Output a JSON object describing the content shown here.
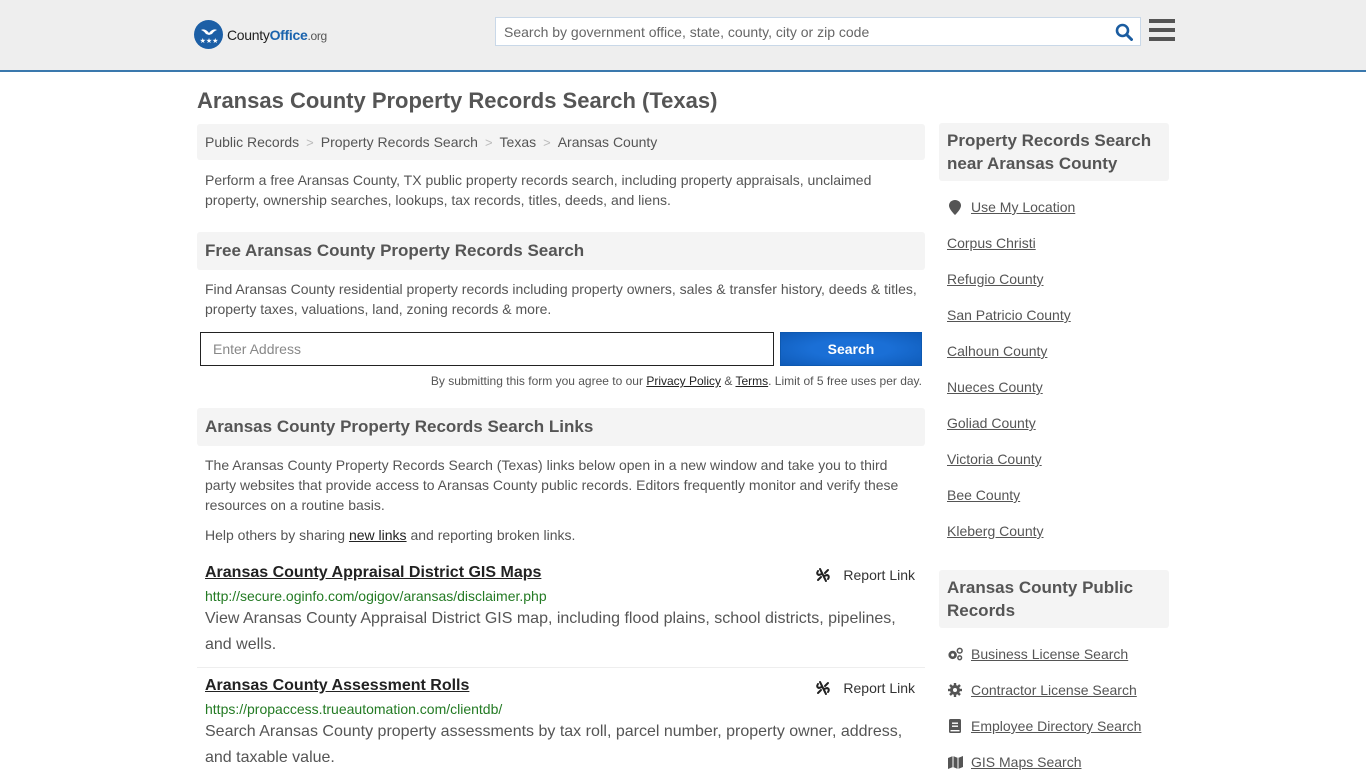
{
  "header": {
    "logo": {
      "county": "County",
      "office": "Office",
      "tld": ".org"
    },
    "search_placeholder": "Search by government office, state, county, city or zip code",
    "search_icon": "search-icon",
    "menu_icon": "hamburger-menu-icon",
    "brand_color": "#1c5fa6",
    "border_color": "#3a78ad"
  },
  "page": {
    "title": "Aransas County Property Records Search (Texas)"
  },
  "breadcrumb": [
    {
      "label": "Public Records"
    },
    {
      "label": "Property Records Search"
    },
    {
      "label": "Texas"
    },
    {
      "label": "Aransas County"
    }
  ],
  "intro": "Perform a free Aransas County, TX public property records search, including property appraisals, unclaimed property, ownership searches, lookups, tax records, titles, deeds, and liens.",
  "free_search": {
    "heading": "Free Aransas County Property Records Search",
    "description": "Find Aransas County residential property records including property owners, sales & transfer history, deeds & titles, property taxes, valuations, land, zoning records & more.",
    "address_placeholder": "Enter Address",
    "address_value": "",
    "button_label": "Search",
    "disclaimer_pre": "By submitting this form you agree to our ",
    "privacy_label": "Privacy Policy",
    "amp": " & ",
    "terms_label": "Terms",
    "disclaimer_post": ". Limit of 5 free uses per day."
  },
  "links_section": {
    "heading": "Aransas County Property Records Search Links",
    "description": "The Aransas County Property Records Search (Texas) links below open in a new window and take you to third party websites that provide access to Aransas County public records. Editors frequently monitor and verify these resources on a routine basis.",
    "help_pre": "Help others by sharing ",
    "help_link": "new links",
    "help_post": " and reporting broken links.",
    "items": [
      {
        "title": "Aransas County Appraisal District GIS Maps",
        "url": "http://secure.oginfo.com/ogigov/aransas/disclaimer.php",
        "description": "View Aransas County Appraisal District GIS map, including flood plains, school districts, pipelines, and wells.",
        "report_label": "Report Link"
      },
      {
        "title": "Aransas County Assessment Rolls",
        "url": "https://propaccess.trueautomation.com/clientdb/",
        "description": "Search Aransas County property assessments by tax roll, parcel number, property owner, address, and taxable value.",
        "report_label": "Report Link"
      }
    ]
  },
  "sidebar": {
    "nearby": {
      "heading": "Property Records Search near Aransas County",
      "use_location": "Use My Location",
      "items": [
        "Corpus Christi",
        "Refugio County",
        "San Patricio County",
        "Calhoun County",
        "Nueces County",
        "Goliad County",
        "Victoria County",
        "Bee County",
        "Kleberg County"
      ]
    },
    "public_records": {
      "heading": "Aransas County Public Records",
      "items": [
        {
          "label": "Business License Search",
          "icon": "gears-icon"
        },
        {
          "label": "Contractor License Search",
          "icon": "gear-icon"
        },
        {
          "label": "Employee Directory Search",
          "icon": "book-icon"
        },
        {
          "label": "GIS Maps Search",
          "icon": "map-icon"
        }
      ]
    }
  }
}
